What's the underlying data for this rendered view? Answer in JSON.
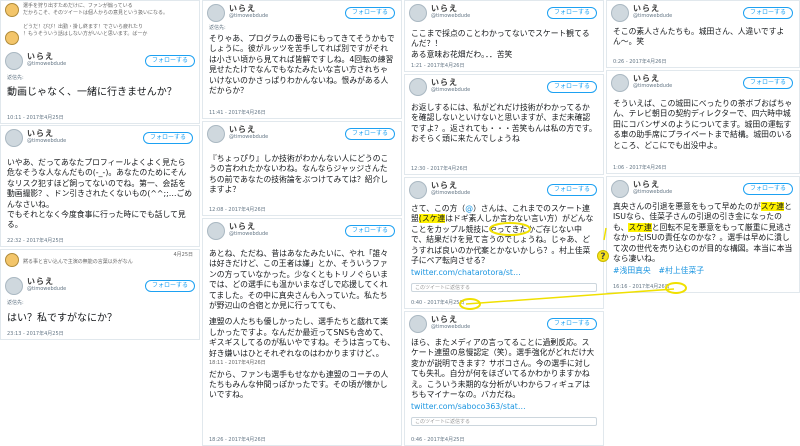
{
  "common": {
    "logo_word": "いらえ",
    "handle": "@timowebdude",
    "follow_label": "フォローする",
    "reply_prefix": "返信先:",
    "search_placeholder": "このツイートに返信する"
  },
  "c1": {
    "top_line1": "選手を狩り出すためだけに、ファンが煽っている",
    "top_line2": "だからこそ、そのツイートは個人からの意見という扱いになる。",
    "time_a": "4月25日",
    "mini_a": "どうだ！びび！出勤・掛し終ます！でさいら疲れたり",
    "mini_b": "！もうそういう話はしない方がいいと思います。ばーか",
    "body": "動画じゃなく、一緒に行きませんか？",
    "meta": "10:11 - 2017年4月25日"
  },
  "c2": {
    "body": "いやあ、だってあなたプロフィールよくよく見たら危なそうな人なんだもの(-_-)。あなたのためにそんなリスク犯すほど飼ってないのでね。第一、会話を動画撮影？、ドン引きされたくないもの(^^;;…ごめんなさいね。\nでもそれとなく今度食事に行った時にでも話して見る。",
    "meta": "22:32 - 2017年4月25日"
  },
  "c3": {
    "time": "4月25日",
    "mini": "黙る事と言い込んで主演の無能の言葉以外がなん",
    "body": "はい？私ですがなにか？",
    "meta": "23:13 - 2017年4月25日"
  },
  "c4": {
    "body": "そりゃあ、プログラムの番号にもってきてそうかもでしょうに。彼がルッツを苦手してれば別ですがそれは小さい頃から見てれば皆解ですしね。4回転の練習見せたたけでなんでもなたみたいな言い方されちゃいけないのかさっぱりわかんないね。恨みがある人だからか？",
    "meta": "11:41 - 2017年4月26日"
  },
  "c5": {
    "body": "『ちょっぴり』しか技術がわかんない人にどうのこうの言われたかないわね。なんならジャッジさんたちの前であなたの技術論をぶつけてみては？紹介しますよ？",
    "meta": "12:08 - 2017年4月26日"
  },
  "c6": {
    "body": "あとね、ただね、昔はあなたみたいに、やれ「誰々は好きだけど、この王者は嫌」とか、そういうファンの方っていなかった。少なくともトリノぐらいまでは、どの選手にも温かいまなざしで応援してくれてました。その中に真央さんも入っていた。私たちが野辺山の合宿とか見に行ってても、",
    "body2": "連盟の人たちも優しかったし、選手たちと戯れて楽しかったですよ。なんだか最近ってSNSも含めて、ギスギスしてるのが私いやですね。そうは言っても、好き嫌いはひとそれぞれなのはわかりますけど、。",
    "body3": "だから、ファンも選手もせなかも連盟のコーチの人たちもみんな仲間っぽかったです。その頃が懐かしいですね。",
    "meta1": "18:11 - 2017年4月26日",
    "meta2": "18:26 - 2017年4月26日"
  },
  "c7": {
    "body": "ここまで採点のことわかってないでスケート観てるんだ？！\nある意味お花畑だわ。．．苦笑",
    "meta": "1:21 - 2017年4月26日"
  },
  "c8": {
    "body": "お返しするには、私がどれだけ技術がわかってるかを確認しないといけないと思いますが、まだ未確認ですよ？。返されても・・・苦笑もんは私の方です。おそらく頭に来たんでしょうね",
    "meta": "12:30 - 2017年4月26日"
  },
  "c9": {
    "pre": "さて、この方（",
    "mention": "@",
    "mid": "）さんは、これまでの",
    "renmei": "スケート連盟",
    "hl1": "(スケ連",
    "rest": "はドギ素人しか言わない言い方）がどんなことをカップル競技にやってきたかご存じない中で、結果だけを見て言うのでしょうね。じゃあ、どうすれば良いのか代案とかないかしら？。村上佳菜子にペア転向させる？",
    "link": "twitter.com/chatarotora/st…",
    "meta": "0:40 - 2017年4月25日"
  },
  "c10": {
    "body": "ほら、またメディアの言ってることに過剰反応。スケート連盟の怠慢認定（笑）。選手強化がどれだけ大変かが説明できます？サボコさん。今の選手に対しても失礼。自分が何をほざいてるかわかりますかねえ。こういう未期的な分析がいわからフィギュアはちもマイナーなの。バカだね。",
    "link": "twitter.com/saboco363/stat…",
    "meta": "0:46 - 2017年4月25日"
  },
  "c11": {
    "body": "そこの素人さんたちも。城田さん、人違いですよん〜。笑",
    "meta": "0:26 - 2017年4月26日"
  },
  "c12": {
    "body": "そういえば、この城田にべったりの茶ボブおばちゃん、テレビ朝日の契約ディレクターで、四六時中城田にコバンザメのようについてます。城田の運転する車の助手席にプライベートまで結構。城田のいるところ、どこにでも出没中よ。",
    "meta": "1:06 - 2017年4月26日"
  },
  "c13": {
    "p1": "真央さんの引退を悪意をもって早めたのが",
    "hl1": "スケ連",
    "p2": "とISUなら、佳菜子さんの引退の引き金になったのも、",
    "hl2": "スケ連",
    "p3": "と回転不足を悪意をもって厳重に見逃さなかったISUの責任なのかな？。選手は早めに潰して次の世代を売り込むのが目的な構図。本当に本当なら凄いね。",
    "tags": "#浅田真央　#村上佳菜子",
    "meta": "16:16 - 2017年4月26日"
  },
  "colors": {
    "accent": "#1da1f2",
    "highlight": "#fff200",
    "link": "#1b95e0",
    "annotation": "#f0e000"
  }
}
